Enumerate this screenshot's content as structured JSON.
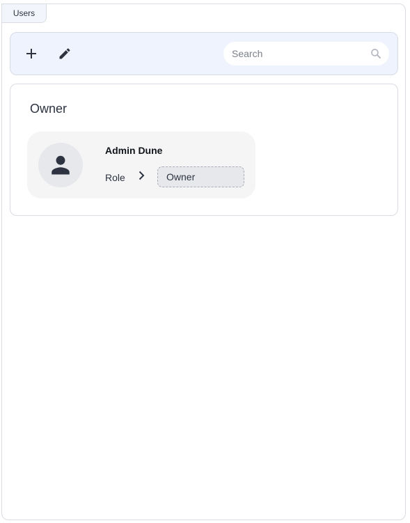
{
  "tabs": [
    {
      "label": "Users"
    }
  ],
  "toolbar": {
    "add_icon": "plus-icon",
    "edit_icon": "pencil-icon",
    "search": {
      "placeholder": "Search",
      "value": "",
      "icon": "search-icon"
    }
  },
  "groups": [
    {
      "title": "Owner",
      "users": [
        {
          "name": "Admin Dune",
          "avatar_icon": "person-icon",
          "role_label": "Role",
          "role_value": "Owner"
        }
      ]
    }
  ],
  "colors": {
    "toolbar_bg": "#eff3fd",
    "card_bg": "#f5f5f6",
    "icon": "#2d3340",
    "border": "#d9dce2"
  }
}
